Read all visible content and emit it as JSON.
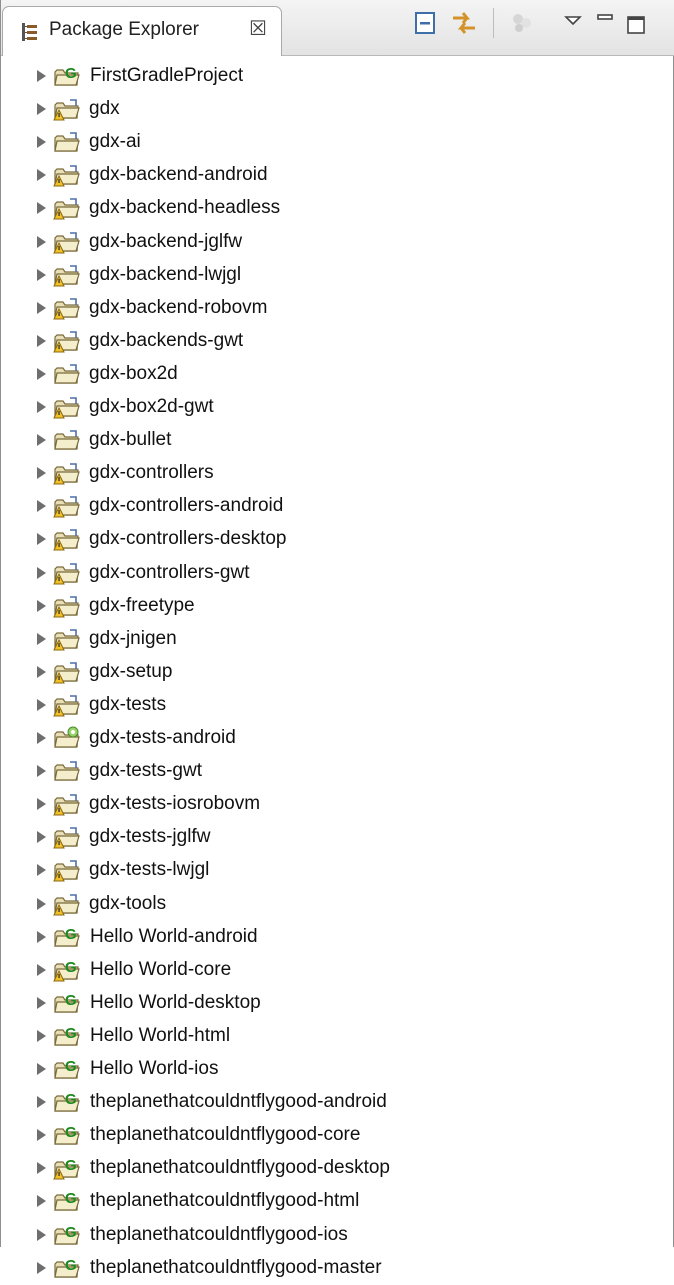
{
  "view": {
    "title": "Package Explorer",
    "close_symbol": "☒",
    "icon": "package-explorer-icon"
  },
  "toolbar": [
    {
      "name": "collapse-all-icon"
    },
    {
      "name": "link-with-editor-icon"
    },
    {
      "name": "focus-on-active-task-icon"
    },
    {
      "name": "view-menu-icon"
    },
    {
      "name": "minimize-icon"
    },
    {
      "name": "maximize-icon"
    }
  ],
  "projects": [
    {
      "label": "FirstGradleProject",
      "icon": "gradle-project-icon"
    },
    {
      "label": "gdx",
      "icon": "warning-folder-icon"
    },
    {
      "label": "gdx-ai",
      "icon": "project-folder-icon"
    },
    {
      "label": "gdx-backend-android",
      "icon": "warning-folder-icon"
    },
    {
      "label": "gdx-backend-headless",
      "icon": "warning-folder-icon"
    },
    {
      "label": "gdx-backend-jglfw",
      "icon": "warning-folder-icon"
    },
    {
      "label": "gdx-backend-lwjgl",
      "icon": "warning-folder-icon"
    },
    {
      "label": "gdx-backend-robovm",
      "icon": "warning-folder-icon"
    },
    {
      "label": "gdx-backends-gwt",
      "icon": "warning-folder-icon"
    },
    {
      "label": "gdx-box2d",
      "icon": "project-folder-icon"
    },
    {
      "label": "gdx-box2d-gwt",
      "icon": "warning-folder-icon"
    },
    {
      "label": "gdx-bullet",
      "icon": "project-folder-icon"
    },
    {
      "label": "gdx-controllers",
      "icon": "warning-folder-icon"
    },
    {
      "label": "gdx-controllers-android",
      "icon": "warning-folder-icon"
    },
    {
      "label": "gdx-controllers-desktop",
      "icon": "warning-folder-icon"
    },
    {
      "label": "gdx-controllers-gwt",
      "icon": "warning-folder-icon"
    },
    {
      "label": "gdx-freetype",
      "icon": "warning-folder-icon"
    },
    {
      "label": "gdx-jnigen",
      "icon": "warning-folder-icon"
    },
    {
      "label": "gdx-setup",
      "icon": "warning-folder-icon"
    },
    {
      "label": "gdx-tests",
      "icon": "warning-folder-icon"
    },
    {
      "label": "gdx-tests-android",
      "icon": "android-folder-icon"
    },
    {
      "label": "gdx-tests-gwt",
      "icon": "project-folder-icon"
    },
    {
      "label": "gdx-tests-iosrobovm",
      "icon": "warning-folder-icon"
    },
    {
      "label": "gdx-tests-jglfw",
      "icon": "warning-folder-icon"
    },
    {
      "label": "gdx-tests-lwjgl",
      "icon": "warning-folder-icon"
    },
    {
      "label": "gdx-tools",
      "icon": "warning-folder-icon"
    },
    {
      "label": "Hello World-android",
      "icon": "gradle-project-icon"
    },
    {
      "label": "Hello World-core",
      "icon": "gradle-warning-project-icon"
    },
    {
      "label": "Hello World-desktop",
      "icon": "gradle-project-icon"
    },
    {
      "label": "Hello World-html",
      "icon": "gradle-project-icon"
    },
    {
      "label": "Hello World-ios",
      "icon": "gradle-project-icon"
    },
    {
      "label": "theplanethatcouldntflygood-android",
      "icon": "gradle-project-icon"
    },
    {
      "label": "theplanethatcouldntflygood-core",
      "icon": "gradle-project-icon"
    },
    {
      "label": "theplanethatcouldntflygood-desktop",
      "icon": "gradle-warning-project-icon"
    },
    {
      "label": "theplanethatcouldntflygood-html",
      "icon": "gradle-project-icon"
    },
    {
      "label": "theplanethatcouldntflygood-ios",
      "icon": "gradle-project-icon"
    },
    {
      "label": "theplanethatcouldntflygood-master",
      "icon": "gradle-project-icon"
    }
  ]
}
